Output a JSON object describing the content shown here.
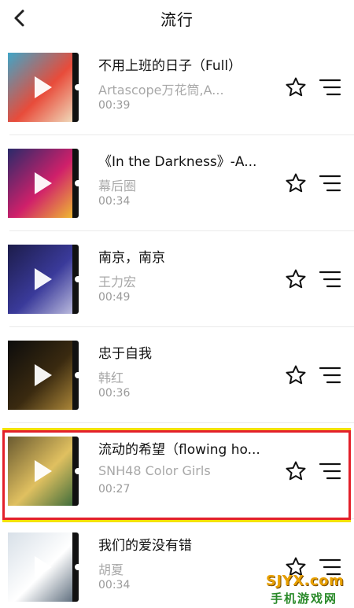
{
  "header": {
    "title": "流行",
    "back_icon": "chevron-left-icon"
  },
  "songs": [
    {
      "title": "不用上班的日子（Full）",
      "artist": "Artascope万花筒,A...",
      "duration": "00:39",
      "cover_colors": [
        "#3fa6c8",
        "#e84b3a",
        "#f0e0c0"
      ]
    },
    {
      "title": "《In the Darkness》-A...",
      "artist": "幕后圈",
      "duration": "00:34",
      "cover_colors": [
        "#2a2a6a",
        "#d0206a",
        "#f0c030"
      ]
    },
    {
      "title": "南京，南京",
      "artist": "王力宏",
      "duration": "00:49",
      "cover_colors": [
        "#1c1c4a",
        "#3a3a9a",
        "#c0c0e0"
      ]
    },
    {
      "title": "忠于自我",
      "artist": "韩红",
      "duration": "00:36",
      "cover_colors": [
        "#0c0c0c",
        "#3a2a10",
        "#b08a3a"
      ]
    },
    {
      "title": "流动的希望（flowing ho...",
      "artist": "SNH48 Color Girls",
      "duration": "00:27",
      "cover_colors": [
        "#6a5a30",
        "#e0c060",
        "#3a6a3a"
      ]
    },
    {
      "title": "我们的爱没有错",
      "artist": "胡夏",
      "duration": "00:34",
      "cover_colors": [
        "#d8e0e8",
        "#ffffff",
        "#5a6a7a"
      ]
    }
  ],
  "icons": {
    "star": "star-outline-icon",
    "queue": "add-to-list-icon",
    "play": "play-icon"
  },
  "highlight_color": "#e3202a",
  "watermark": {
    "top": "SJYX.com",
    "bottom": "手机游戏网"
  }
}
